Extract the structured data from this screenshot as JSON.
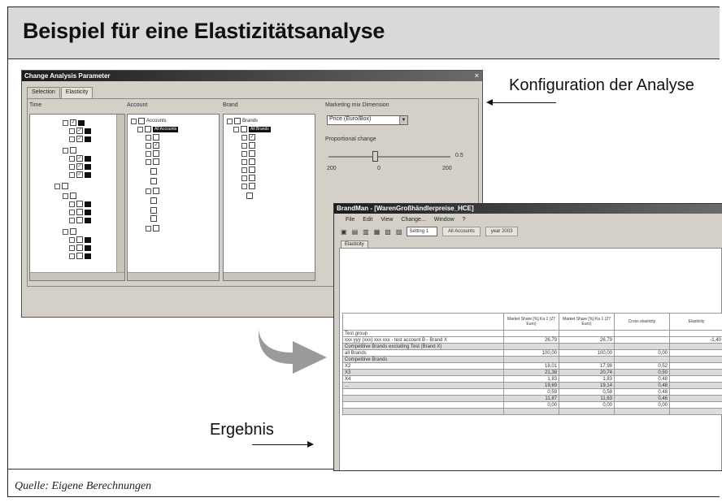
{
  "header": {
    "title": "Beispiel für eine Elastizitätsanalyse"
  },
  "footer": {
    "source": "Quelle: Eigene Berechnungen"
  },
  "annotations": {
    "config_label": "Konfiguration der Analyse",
    "result_label": "Ergebnis"
  },
  "param_dialog": {
    "title": "Change Analysis Parameter",
    "close": "×",
    "tabs": [
      "Selection",
      "Elasticity"
    ],
    "columns": {
      "time": "Time",
      "account": "Account",
      "brand": "Brand",
      "dimension": "Marketing mix Dimension"
    },
    "dimension_value": "Price (Euro/Box)",
    "proportional_label": "Proportional change",
    "slider_value": "0.5",
    "scale": {
      "min": "200",
      "mid": "0",
      "max": "200"
    },
    "account_root": "Accounts",
    "account_all": "All Accounts",
    "brand_root": "Brands",
    "brand_all": "All Brands"
  },
  "result_window": {
    "title": "BrandMan - [WarenGroßhändlerpreise_HCE]",
    "menu": [
      "File",
      "Edit",
      "View",
      "Change...",
      "Window",
      "?"
    ],
    "toolbar_dropdown": "Setting 1",
    "toolbar_fields": [
      "All Accounts",
      "year 2003"
    ],
    "tab": "Elasticity",
    "table": {
      "headers": [
        "",
        "Market Share [%] Ka 1 (27 Euro)",
        "Market Share [%] Ka 1 (27 Euro)",
        "Cross elasticity",
        "Elasticity"
      ],
      "rows": [
        {
          "label": "Test group",
          "v": [
            "",
            "",
            "",
            ""
          ],
          "grey": false
        },
        {
          "label": "xxx yyy (xxx) xxx xxx - test account B - Brand X",
          "v": [
            "26,79",
            "26,79",
            "",
            "-1,40"
          ],
          "grey": false
        },
        {
          "label": "Competitive Brands excluding Test (Brand X)",
          "v": [
            "",
            "",
            "",
            ""
          ],
          "grey": true
        },
        {
          "label": "all Brands",
          "v": [
            "100,00",
            "100,00",
            "0,00",
            ""
          ],
          "grey": false
        },
        {
          "label": "Competitive Brands",
          "v": [
            "",
            "",
            "",
            ""
          ],
          "grey": true
        },
        {
          "label": "  X2",
          "v": [
            "18,01",
            "17,98",
            "0,52",
            ""
          ],
          "grey": false
        },
        {
          "label": "  X3",
          "v": [
            "21,38",
            "20,74",
            "0,50",
            ""
          ],
          "grey": true
        },
        {
          "label": "  X4",
          "v": [
            "1,83",
            "1,83",
            "0,48",
            ""
          ],
          "grey": false
        },
        {
          "label": "  ...",
          "v": [
            "19,69",
            "19,14",
            "0,48",
            ""
          ],
          "grey": true
        },
        {
          "label": "",
          "v": [
            "0,59",
            "0,58",
            "0,48",
            ""
          ],
          "grey": false
        },
        {
          "label": "",
          "v": [
            "11,87",
            "11,63",
            "0,46",
            ""
          ],
          "grey": true
        },
        {
          "label": "",
          "v": [
            "0,00",
            "0,00",
            "0,00",
            ""
          ],
          "grey": false
        },
        {
          "label": "",
          "v": [
            "",
            "",
            "",
            ""
          ],
          "grey": true
        }
      ]
    }
  }
}
